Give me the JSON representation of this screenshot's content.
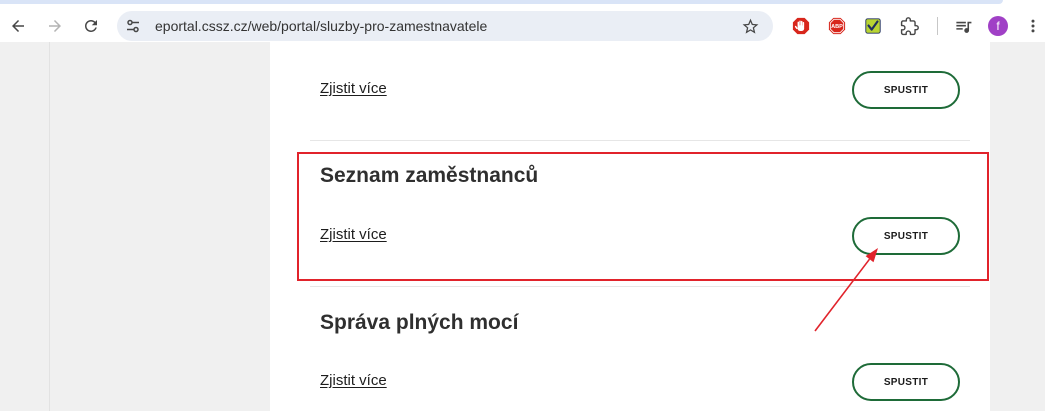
{
  "browser": {
    "nav": {
      "back_icon": "arrow-left-icon",
      "forward_icon": "arrow-right-icon",
      "reload_icon": "reload-icon"
    },
    "omnibox": {
      "site_info_icon": "tune-icon",
      "url": "eportal.cssz.cz/web/portal/sluzby-pro-zamestnavatele",
      "bookmark_icon": "star-outline-icon"
    },
    "extensions": [
      {
        "icon": "adblock-hand-icon",
        "color": "#d8261c"
      },
      {
        "icon": "adblock-plus-icon",
        "label": "ABP",
        "color": "#d8261c"
      },
      {
        "icon": "green-check-icon",
        "color": "#b8d432"
      },
      {
        "icon": "puzzle-icon"
      }
    ],
    "media_icon": "queue-music-icon",
    "profile": {
      "initial": "f"
    },
    "menu_icon": "kebab-menu-icon"
  },
  "page": {
    "services": [
      {
        "link_label": "Zjistit více",
        "button_label": "SPUSTIT"
      },
      {
        "title": "Seznam zaměstnanců",
        "link_label": "Zjistit více",
        "button_label": "SPUSTIT",
        "highlighted": true
      },
      {
        "title": "Správa plných mocí",
        "link_label": "Zjistit více",
        "button_label": "SPUSTIT"
      }
    ]
  },
  "colors": {
    "button_border": "#1e6b38",
    "annotation": "#e1232b",
    "profile": "#a040c6"
  }
}
